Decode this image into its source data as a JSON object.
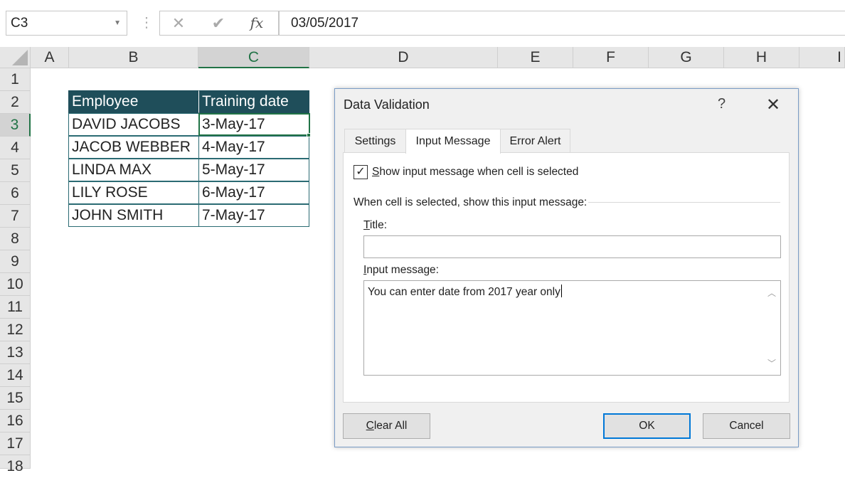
{
  "formula_bar": {
    "name_box": "C3",
    "cancel_icon": "✕",
    "enter_icon": "✔",
    "fx_label": "fx",
    "formula": "03/05/2017"
  },
  "columns": [
    "A",
    "B",
    "C",
    "D",
    "E",
    "F",
    "G",
    "H",
    "I"
  ],
  "selected_column": "C",
  "rows": [
    "1",
    "2",
    "3",
    "4",
    "5",
    "6",
    "7",
    "8",
    "9",
    "10",
    "11",
    "12",
    "13",
    "14",
    "15",
    "16",
    "17",
    "18"
  ],
  "selected_row": "3",
  "table": {
    "headers": [
      "Employee",
      "Training date"
    ],
    "rows": [
      [
        "DAVID JACOBS",
        "3-May-17"
      ],
      [
        "JACOB WEBBER",
        "4-May-17"
      ],
      [
        "LINDA MAX",
        "5-May-17"
      ],
      [
        "LILY ROSE",
        "6-May-17"
      ],
      [
        "JOHN SMITH",
        "7-May-17"
      ]
    ]
  },
  "dialog": {
    "title": "Data Validation",
    "help": "?",
    "close": "✕",
    "tabs": [
      "Settings",
      "Input Message",
      "Error Alert"
    ],
    "active_tab": "Input Message",
    "checkbox_checked": true,
    "checkbox_mark": "✓",
    "checkbox_label_key": "S",
    "checkbox_label_rest": "how input message when cell is selected",
    "section_label": "When cell is selected, show this input message:",
    "title_label_key": "T",
    "title_label_rest": "itle:",
    "title_value": "",
    "message_label_key": "I",
    "message_label_rest": "nput message:",
    "message_value": "You can enter date from 2017 year only",
    "clear_all_key": "C",
    "clear_all_rest": "lear All",
    "ok_label": "OK",
    "cancel_label": "Cancel"
  },
  "colors": {
    "header_fill": "#1f4e5a",
    "selection": "#217346",
    "dialog_border": "#7a9cc6",
    "ok_focus": "#0078d7"
  }
}
